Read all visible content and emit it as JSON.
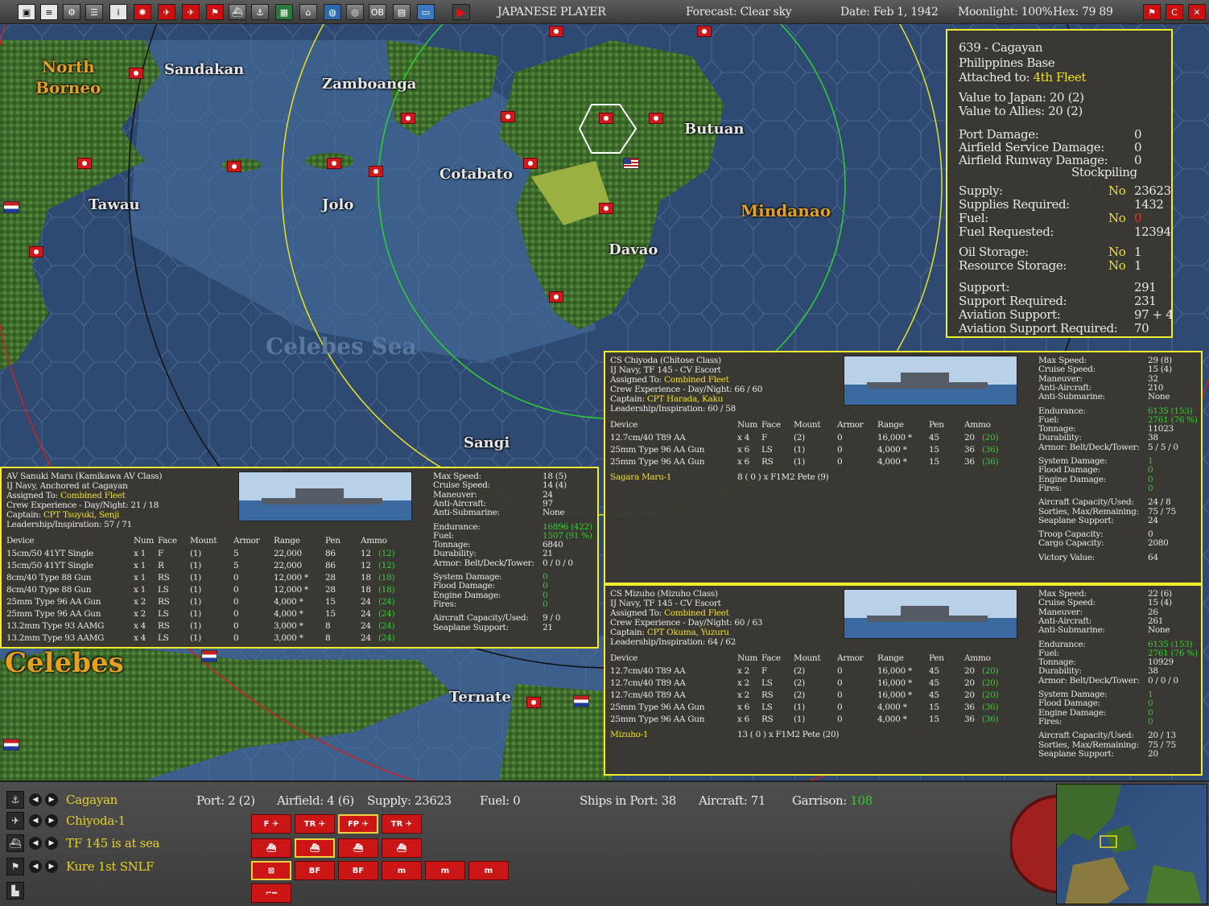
{
  "topbar": {
    "player": "JAPANESE PLAYER",
    "forecast": "Forecast: Clear sky",
    "date": "Date: Feb 1, 1942",
    "moonlight": "Moonlight: 100%",
    "hex": "Hex: 79  89",
    "buttons": [
      "save",
      "report",
      "gear",
      "list",
      "info",
      "jp-flag",
      "air",
      "air2",
      "flag",
      "ship",
      "sub",
      "map",
      "port",
      "globe",
      "target",
      "OB",
      "grid",
      "screen",
      "play"
    ],
    "ob_label": "OB"
  },
  "map": {
    "places": {
      "north_borneo": "North\nBorneo",
      "sandakan": "Sandakan",
      "zamboanga": "Zamboanga",
      "butuan": "Butuan",
      "cotabato": "Cotabato",
      "tawau": "Tawau",
      "jolo": "Jolo",
      "mindanao": "Mindanao",
      "davao": "Davao",
      "celebes_sea": "Celebes Sea",
      "sangi": "Sangi",
      "celebes": "Celebes",
      "ternate": "Ternate"
    }
  },
  "base_panel": {
    "title": "639 - Cagayan",
    "type": "Philippines Base",
    "attached_label": "Attached to:",
    "attached_value": "4th Fleet",
    "value_japan": "Value to Japan: 20 (2)",
    "value_allies": "Value to Allies: 20 (2)",
    "port_damage_label": "Port Damage:",
    "port_damage": "0",
    "af_service_label": "Airfield Service Damage:",
    "af_service": "0",
    "af_runway_label": "Airfield Runway Damage:",
    "af_runway": "0",
    "stockpiling": "Stockpiling",
    "supply_label": "Supply:",
    "supply_flag": "No",
    "supply": "23623",
    "supplies_req_label": "Supplies Required:",
    "supplies_req": "1432",
    "fuel_label": "Fuel:",
    "fuel_flag": "No",
    "fuel": "0",
    "fuel_req_label": "Fuel Requested:",
    "fuel_req": "12394",
    "oil_label": "Oil Storage:",
    "oil_flag": "No",
    "oil": "1",
    "resource_label": "Resource Storage:",
    "resource_flag": "No",
    "resource": "1",
    "support_label": "Support:",
    "support": "291",
    "support_req_label": "Support Required:",
    "support_req": "231",
    "avsupport_label": "Aviation Support:",
    "avsupport": "97 + 44",
    "avsupport_req_label": "Aviation Support Required:",
    "avsupport_req": "70"
  },
  "ship_chiyoda": {
    "l1": "CS Chiyoda (Chitose Class)",
    "l2": "IJ Navy, TF 145 - CV Escort",
    "assigned_label": "Assigned To:",
    "assigned": "Combined Fleet",
    "crew": "Crew Experience - Day/Night: 66 / 60",
    "captain_label": "Captain:",
    "captain": "CPT Harada, Kaku",
    "leader": "Leadership/Inspiration: 60 / 58",
    "headers": [
      "Device",
      "Num",
      "Face",
      "Mount",
      "Armor",
      "Range",
      "Pen",
      "Ammo"
    ],
    "devices": [
      {
        "name": "12.7cm/40 T89 AA",
        "num": "x 4",
        "face": "F",
        "mount": "(2)",
        "armor": "0",
        "range": "16,000 *",
        "pen": "45",
        "ammo": "20",
        "ammo2": "(20)"
      },
      {
        "name": "25mm Type 96 AA Gun",
        "num": "x 6",
        "face": "LS",
        "mount": "(1)",
        "armor": "0",
        "range": "4,000 *",
        "pen": "15",
        "ammo": "36",
        "ammo2": "(36)"
      },
      {
        "name": "25mm Type 96 AA Gun",
        "num": "x 6",
        "face": "RS",
        "mount": "(1)",
        "armor": "0",
        "range": "4,000 *",
        "pen": "15",
        "ammo": "36",
        "ammo2": "(36)"
      }
    ],
    "air_group": "Sagara Maru-1",
    "air_desc": "8 ( 0 ) x F1M2 Pete (9)",
    "stats": [
      {
        "l": "Max Speed:",
        "v": "29 (8)"
      },
      {
        "l": "Cruise Speed:",
        "v": "15 (4)"
      },
      {
        "l": "Maneuver:",
        "v": "32"
      },
      {
        "l": "Anti-Aircraft:",
        "v": "210"
      },
      {
        "l": "Anti-Submarine:",
        "v": "None"
      },
      {
        "l": "Endurance:",
        "v": "6135 (153)",
        "c": "g"
      },
      {
        "l": "Fuel:",
        "v": "2761 (76 %)",
        "c": "g"
      },
      {
        "l": "Tonnage:",
        "v": "11023"
      },
      {
        "l": "Durability:",
        "v": "38"
      },
      {
        "l": "Armor: Belt/Deck/Tower:",
        "v": "5 / 5 / 0"
      },
      {
        "l": "System Damage:",
        "v": "1",
        "c": "g"
      },
      {
        "l": "Flood Damage:",
        "v": "0",
        "c": "g"
      },
      {
        "l": "Engine Damage:",
        "v": "0",
        "c": "g"
      },
      {
        "l": "Fires:",
        "v": "0",
        "c": "g"
      },
      {
        "l": "Aircraft Capacity/Used:",
        "v": "24 / 8"
      },
      {
        "l": "Sorties, Max/Remaining:",
        "v": "75 / 75"
      },
      {
        "l": "Seaplane Support:",
        "v": "24"
      },
      {
        "l": "Troop Capacity:",
        "v": "0"
      },
      {
        "l": "Cargo Capacity:",
        "v": "2080"
      },
      {
        "l": "Victory Value:",
        "v": "64"
      }
    ]
  },
  "ship_sanuki": {
    "l1": "AV Sanuki Maru (Kamikawa AV Class)",
    "l2": "IJ Navy, Anchored at Cagayan",
    "assigned_label": "Assigned To:",
    "assigned": "Combined Fleet",
    "crew": "Crew Experience - Day/Night: 21 / 18",
    "captain_label": "Captain:",
    "captain": "CPT Tsuyuki, Senji",
    "leader": "Leadership/Inspiration: 57 / 71",
    "headers": [
      "Device",
      "Num",
      "Face",
      "Mount",
      "Armor",
      "Range",
      "Pen",
      "Ammo"
    ],
    "devices": [
      {
        "name": "15cm/50 41YT Single",
        "num": "x 1",
        "face": "F",
        "mount": "(1)",
        "armor": "5",
        "range": "22,000",
        "pen": "86",
        "ammo": "12",
        "ammo2": "(12)"
      },
      {
        "name": "15cm/50 41YT Single",
        "num": "x 1",
        "face": "R",
        "mount": "(1)",
        "armor": "5",
        "range": "22,000",
        "pen": "86",
        "ammo": "12",
        "ammo2": "(12)"
      },
      {
        "name": "8cm/40 Type 88 Gun",
        "num": "x 1",
        "face": "RS",
        "mount": "(1)",
        "armor": "0",
        "range": "12,000 *",
        "pen": "28",
        "ammo": "18",
        "ammo2": "(18)"
      },
      {
        "name": "8cm/40 Type 88 Gun",
        "num": "x 1",
        "face": "LS",
        "mount": "(1)",
        "armor": "0",
        "range": "12,000 *",
        "pen": "28",
        "ammo": "18",
        "ammo2": "(18)"
      },
      {
        "name": "25mm Type 96 AA Gun",
        "num": "x 2",
        "face": "RS",
        "mount": "(1)",
        "armor": "0",
        "range": "4,000 *",
        "pen": "15",
        "ammo": "24",
        "ammo2": "(24)"
      },
      {
        "name": "25mm Type 96 AA Gun",
        "num": "x 2",
        "face": "LS",
        "mount": "(1)",
        "armor": "0",
        "range": "4,000 *",
        "pen": "15",
        "ammo": "24",
        "ammo2": "(24)"
      },
      {
        "name": "13.2mm Type 93 AAMG",
        "num": "x 4",
        "face": "RS",
        "mount": "(1)",
        "armor": "0",
        "range": "3,000 *",
        "pen": "8",
        "ammo": "24",
        "ammo2": "(24)"
      },
      {
        "name": "13.2mm Type 93 AAMG",
        "num": "x 4",
        "face": "LS",
        "mount": "(1)",
        "armor": "0",
        "range": "3,000 *",
        "pen": "8",
        "ammo": "24",
        "ammo2": "(24)"
      }
    ],
    "stats": [
      {
        "l": "Max Speed:",
        "v": "18 (5)"
      },
      {
        "l": "Cruise Speed:",
        "v": "14 (4)"
      },
      {
        "l": "Maneuver:",
        "v": "24"
      },
      {
        "l": "Anti-Aircraft:",
        "v": "97"
      },
      {
        "l": "Anti-Submarine:",
        "v": "None"
      },
      {
        "l": "Endurance:",
        "v": "16896 (422)",
        "c": "g"
      },
      {
        "l": "Fuel:",
        "v": "1507 (91 %)",
        "c": "g"
      },
      {
        "l": "Tonnage:",
        "v": "6840"
      },
      {
        "l": "Durability:",
        "v": "21"
      },
      {
        "l": "Armor: Belt/Deck/Tower:",
        "v": "0 / 0 / 0"
      },
      {
        "l": "System Damage:",
        "v": "0",
        "c": "g"
      },
      {
        "l": "Flood Damage:",
        "v": "0",
        "c": "g"
      },
      {
        "l": "Engine Damage:",
        "v": "0",
        "c": "g"
      },
      {
        "l": "Fires:",
        "v": "0",
        "c": "g"
      },
      {
        "l": "Aircraft Capacity/Used:",
        "v": "9 / 0"
      },
      {
        "l": "Seaplane Support:",
        "v": "21"
      }
    ]
  },
  "ship_mizuho": {
    "l1": "CS Mizuho (Mizuho Class)",
    "l2": "IJ Navy, TF 145 - CV Escort",
    "assigned_label": "Assigned To:",
    "assigned": "Combined Fleet",
    "crew": "Crew Experience - Day/Night: 60 / 63",
    "captain_label": "Captain:",
    "captain": "CPT Okuma, Yuzuru",
    "leader": "Leadership/Inspiration: 64 / 62",
    "headers": [
      "Device",
      "Num",
      "Face",
      "Mount",
      "Armor",
      "Range",
      "Pen",
      "Ammo"
    ],
    "devices": [
      {
        "name": "12.7cm/40 T89 AA",
        "num": "x 2",
        "face": "F",
        "mount": "(2)",
        "armor": "0",
        "range": "16,000 *",
        "pen": "45",
        "ammo": "20",
        "ammo2": "(20)"
      },
      {
        "name": "12.7cm/40 T89 AA",
        "num": "x 2",
        "face": "LS",
        "mount": "(2)",
        "armor": "0",
        "range": "16,000 *",
        "pen": "45",
        "ammo": "20",
        "ammo2": "(20)"
      },
      {
        "name": "12.7cm/40 T89 AA",
        "num": "x 2",
        "face": "RS",
        "mount": "(2)",
        "armor": "0",
        "range": "16,000 *",
        "pen": "45",
        "ammo": "20",
        "ammo2": "(20)"
      },
      {
        "name": "25mm Type 96 AA Gun",
        "num": "x 6",
        "face": "LS",
        "mount": "(1)",
        "armor": "0",
        "range": "4,000 *",
        "pen": "15",
        "ammo": "36",
        "ammo2": "(36)"
      },
      {
        "name": "25mm Type 96 AA Gun",
        "num": "x 6",
        "face": "RS",
        "mount": "(1)",
        "armor": "0",
        "range": "4,000 *",
        "pen": "15",
        "ammo": "36",
        "ammo2": "(36)"
      }
    ],
    "air_group": "Mizuho-1",
    "air_desc": "13 ( 0 ) x F1M2 Pete (20)",
    "stats": [
      {
        "l": "Max Speed:",
        "v": "22 (6)"
      },
      {
        "l": "Cruise Speed:",
        "v": "15 (4)"
      },
      {
        "l": "Maneuver:",
        "v": "26"
      },
      {
        "l": "Anti-Aircraft:",
        "v": "261"
      },
      {
        "l": "Anti-Submarine:",
        "v": "None"
      },
      {
        "l": "Endurance:",
        "v": "6135 (153)",
        "c": "g"
      },
      {
        "l": "Fuel:",
        "v": "2761 (76 %)",
        "c": "g"
      },
      {
        "l": "Tonnage:",
        "v": "10929"
      },
      {
        "l": "Durability:",
        "v": "38"
      },
      {
        "l": "Armor: Belt/Deck/Tower:",
        "v": "0 / 0 / 0"
      },
      {
        "l": "System Damage:",
        "v": "1",
        "c": "g"
      },
      {
        "l": "Flood Damage:",
        "v": "0",
        "c": "g"
      },
      {
        "l": "Engine Damage:",
        "v": "0",
        "c": "g"
      },
      {
        "l": "Fires:",
        "v": "0",
        "c": "g"
      },
      {
        "l": "Aircraft Capacity/Used:",
        "v": "20 / 13"
      },
      {
        "l": "Sorties, Max/Remaining:",
        "v": "75 / 75"
      },
      {
        "l": "Seaplane Support:",
        "v": "20"
      }
    ]
  },
  "bottom": {
    "rows": [
      {
        "icon": "⚓",
        "name": "Cagayan"
      },
      {
        "icon": "✈",
        "name": "Chiyoda-1"
      },
      {
        "icon": "⛴",
        "name": "TF 145 is at sea"
      },
      {
        "icon": "⚑",
        "name": "Kure 1st SNLF"
      }
    ],
    "port": "Port: 2 (2)",
    "airfield": "Airfield: 4 (6)",
    "supply": "Supply: 23623",
    "fuel": "Fuel: 0",
    "ships": "Ships in Port: 38",
    "aircraft": "Aircraft: 71",
    "garrison_label": "Garrison:",
    "garrison": "108",
    "air_buttons": [
      "F",
      "TR",
      "FP",
      "TR"
    ],
    "base_buttons": [
      "⊠",
      "BF",
      "BF",
      "m",
      "m",
      "m"
    ]
  }
}
